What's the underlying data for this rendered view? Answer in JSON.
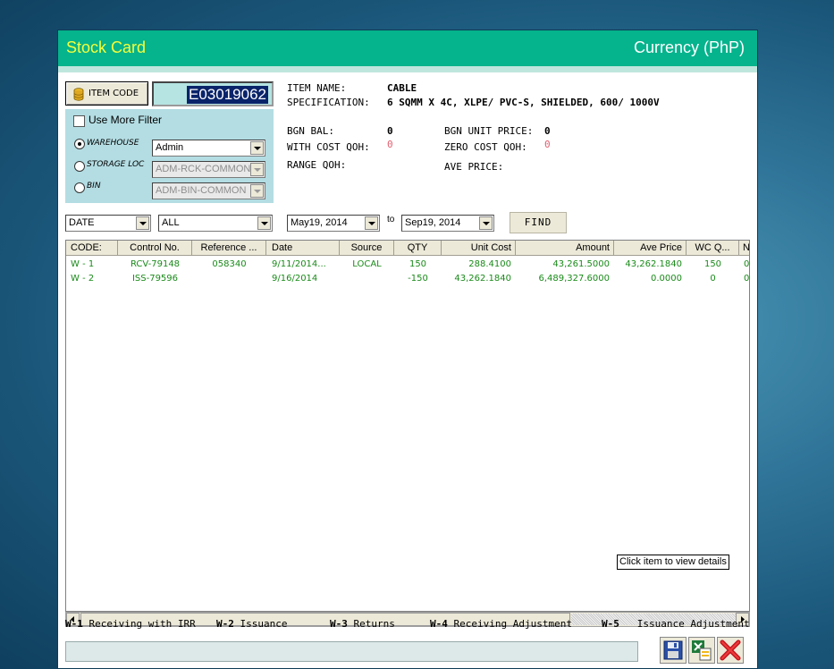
{
  "window": {
    "title": "Stock Card",
    "currency": "Currency (PhP)"
  },
  "item_code": {
    "button_label": "ITEM CODE",
    "value": "E03019062"
  },
  "filter": {
    "use_more_filter_label": "Use More Filter",
    "options": [
      {
        "label": "WAREHOUSE",
        "value": "Admin",
        "selected": true,
        "enabled": true
      },
      {
        "label": "STORAGE LOC",
        "value": "ADM-RCK-COMMON",
        "selected": false,
        "enabled": false
      },
      {
        "label": "BIN",
        "value": "ADM-BIN-COMMON",
        "selected": false,
        "enabled": false
      }
    ]
  },
  "info": {
    "item_name_label": "ITEM NAME:",
    "item_name": "CABLE",
    "specification_label": "SPECIFICATION:",
    "specification": "6 SQMM X 4C, XLPE/ PVC-S, SHIELDED, 600/ 1000V",
    "bgn_bal_label": "BGN BAL:",
    "bgn_bal": "0",
    "bgn_unit_price_label": "BGN UNIT PRICE:",
    "bgn_unit_price": "0",
    "with_cost_qoh_label": "WITH COST QOH:",
    "with_cost_qoh": "0",
    "zero_cost_qoh_label": "ZERO COST QOH:",
    "zero_cost_qoh": "0",
    "range_qoh_label": "RANGE QOH:",
    "ave_price_label": "AVE PRICE:",
    "warn_color": "#e06070"
  },
  "date_filter": {
    "type": "DATE",
    "scope": "ALL",
    "from": "May19, 2014",
    "to_label": "to",
    "to": "Sep19, 2014",
    "find_label": "FIND"
  },
  "grid": {
    "columns": [
      "CODE:",
      "Control No.",
      "Reference ...",
      "Date",
      "Source",
      "QTY",
      "Unit Cost",
      "Amount",
      "Ave Price",
      "WC Q...",
      "N"
    ],
    "rows": [
      [
        "W - 1",
        "RCV-79148",
        "058340",
        "9/11/2014...",
        "LOCAL",
        "150",
        "288.4100",
        "43,261.5000",
        "43,262.1840",
        "150",
        "0"
      ],
      [
        "W - 2",
        "ISS-79596",
        "",
        "9/16/2014",
        "",
        "-150",
        "43,262.1840",
        "6,489,327.6000",
        "0.0000",
        "0",
        "0"
      ]
    ],
    "row_color": "#1a8a1a",
    "tooltip": "Click item to view details"
  },
  "legend": [
    {
      "code": "W-1",
      "label": "Receiving with IRR"
    },
    {
      "code": "W-2",
      "label": "Issuance"
    },
    {
      "code": "W-3",
      "label": "Returns"
    },
    {
      "code": "W-4",
      "label": "Receiving Adjustment"
    },
    {
      "code": "W-5",
      "label": "Issuance Adjustment"
    }
  ],
  "footer_buttons": [
    "save-icon",
    "export-excel-icon",
    "close-icon"
  ]
}
